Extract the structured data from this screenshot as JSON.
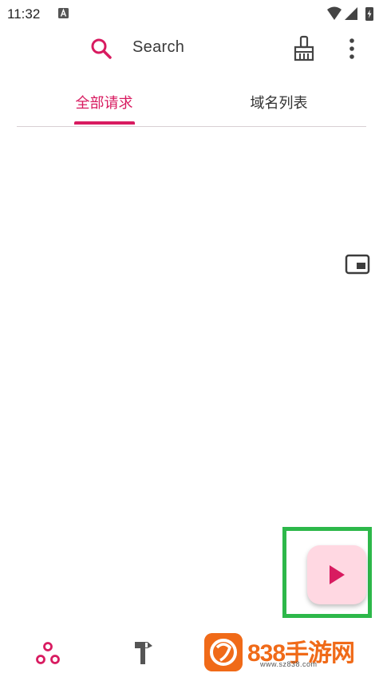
{
  "status_bar": {
    "time": "11:32"
  },
  "search": {
    "placeholder": "Search"
  },
  "tabs": [
    {
      "label": "全部请求",
      "selected": true
    },
    {
      "label": "域名列表",
      "selected": false
    }
  ],
  "colors": {
    "accent": "#d81b60",
    "fab_bg": "#ffd8e2",
    "highlight": "#2db84a"
  },
  "icons": {
    "search": "search-icon",
    "clear": "broom-icon",
    "more": "more-vert-icon",
    "pip": "picture-in-picture-icon",
    "fab": "play-icon",
    "nav_1": "circles-icon",
    "nav_2": "hammer-icon"
  },
  "watermark": {
    "brand": "838手游网",
    "url": "www.sz838.com"
  }
}
